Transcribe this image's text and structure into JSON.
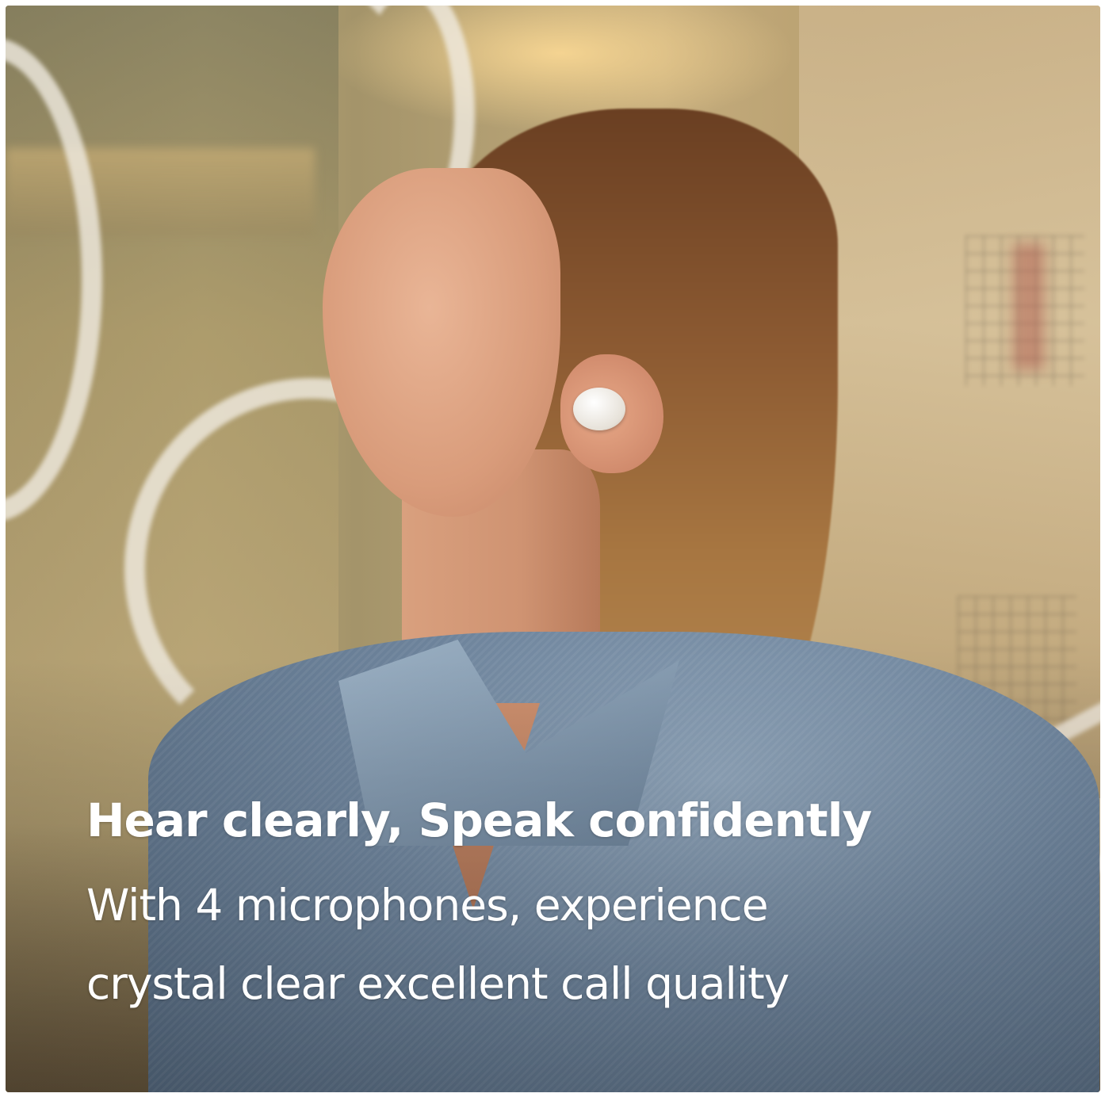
{
  "overlay": {
    "headline": "Hear clearly, Speak confidently",
    "subline_1": "With 4 microphones, experience",
    "subline_2": "crystal clear excellent call quality"
  },
  "colors": {
    "text": "#ffffff",
    "background_tone": "#b59a6c",
    "jacket": "#6d839b",
    "hair": "#8c5a32",
    "earbud": "#f2efe8"
  }
}
